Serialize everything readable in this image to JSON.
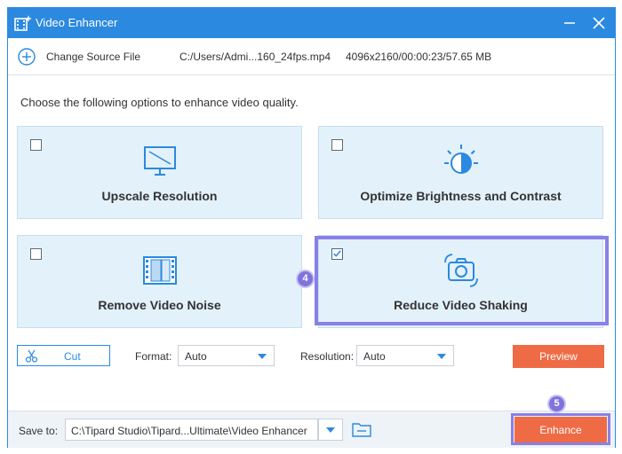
{
  "window": {
    "title": "Video Enhancer",
    "icons": {
      "app": "film-sparkle-icon",
      "minimize": "minimize-icon",
      "close": "close-icon"
    }
  },
  "source_bar": {
    "change_label": "Change Source File",
    "file_path": "C:/Users/Admi...160_24fps.mp4",
    "file_info": "4096x2160/00:00:23/57.65 MB",
    "icon": "plus-circle-icon"
  },
  "instruction": "Choose the following options to enhance video quality.",
  "options": [
    {
      "label": "Upscale Resolution",
      "checked": false,
      "icon": "monitor-upscale-icon"
    },
    {
      "label": "Optimize Brightness and Contrast",
      "checked": false,
      "icon": "brightness-icon"
    },
    {
      "label": "Remove Video Noise",
      "checked": false,
      "icon": "film-noise-icon"
    },
    {
      "label": "Reduce Video Shaking",
      "checked": true,
      "icon": "camera-stabilize-icon"
    }
  ],
  "step_badges": {
    "step4": "4",
    "step5": "5"
  },
  "controls": {
    "cut_label": "Cut",
    "format_label": "Format:",
    "format_value": "Auto",
    "resolution_label": "Resolution:",
    "resolution_value": "Auto",
    "preview_label": "Preview"
  },
  "bottom": {
    "save_label": "Save to:",
    "save_path": "C:\\Tipard Studio\\Tipard...Ultimate\\Video Enhancer",
    "enhance_label": "Enhance"
  },
  "colors": {
    "accent": "#2b89df",
    "card_bg": "#e3f1fb",
    "action": "#ef6b45",
    "highlight": "#8a80e6"
  }
}
